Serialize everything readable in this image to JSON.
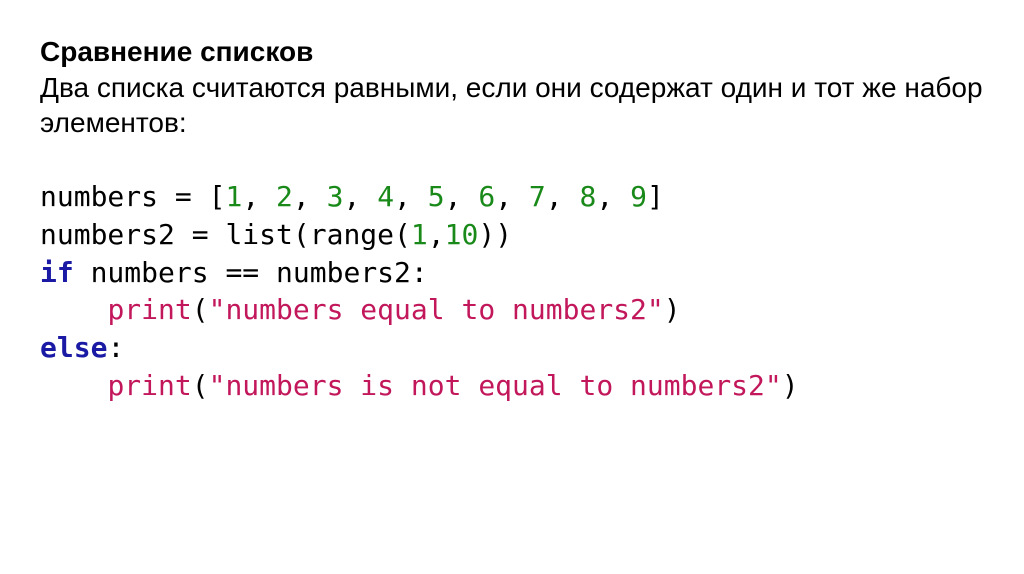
{
  "heading": "Сравнение списков",
  "subheading": "Два списка считаются равными, если они содержат один и тот же набор элементов:",
  "code": {
    "l1": {
      "var": "numbers",
      "eq": " = ",
      "lb": "[",
      "n1": "1",
      "c1": ", ",
      "n2": "2",
      "c2": ", ",
      "n3": "3",
      "c3": ", ",
      "n4": "4",
      "c4": ", ",
      "n5": "5",
      "c5": ", ",
      "n6": "6",
      "c6": ", ",
      "n7": "7",
      "c7": ", ",
      "n8": "8",
      "c8": ", ",
      "n9": "9",
      "rb": "]"
    },
    "l2": {
      "var": "numbers2",
      "eq": " = ",
      "list": "list",
      "lp1": "(",
      "range": "range",
      "lp2": "(",
      "a1": "1",
      "comma": ",",
      "a2": "10",
      "rp2": ")",
      "rp1": ")"
    },
    "l3": {
      "kw_if": "if",
      "sp1": " ",
      "lhs": "numbers",
      "eqeq": " == ",
      "rhs": "numbers2",
      "colon": ":"
    },
    "l4": {
      "indent": "    ",
      "print": "print",
      "lp": "(",
      "str": "\"numbers equal to numbers2\"",
      "rp": ")"
    },
    "l5": {
      "kw_else": "else",
      "colon": ":"
    },
    "l6": {
      "indent": "    ",
      "print": "print",
      "lp": "(",
      "str": "\"numbers is not equal to numbers2\"",
      "rp": ")"
    }
  }
}
